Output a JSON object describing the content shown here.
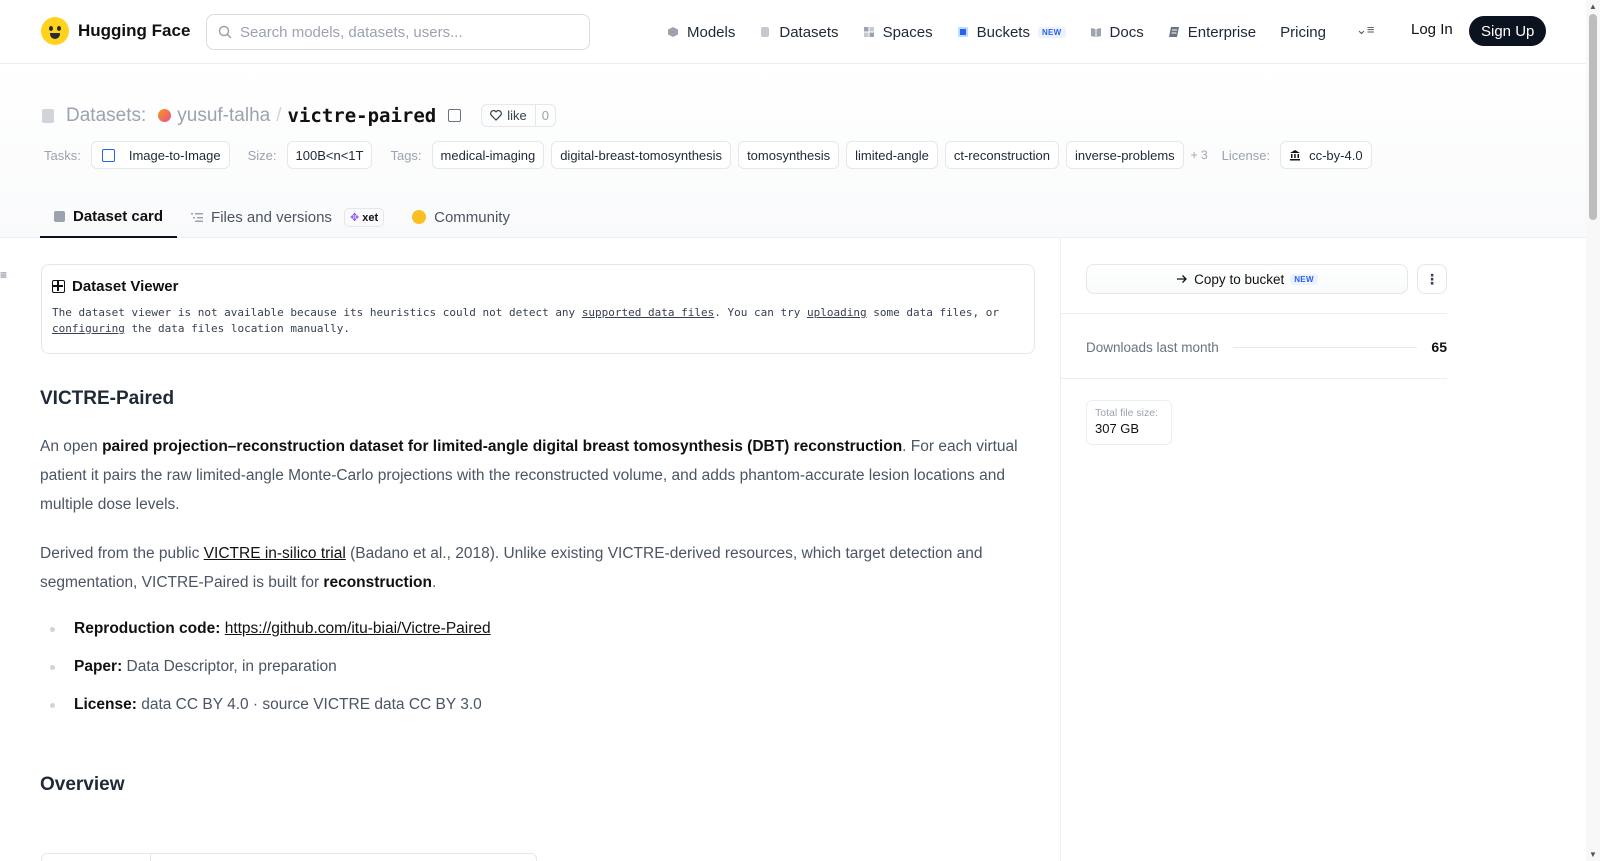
{
  "nav": {
    "brand": "Hugging Face",
    "search_placeholder": "Search models, datasets, users...",
    "links": [
      {
        "label": "Models",
        "icon": "cube-icon"
      },
      {
        "label": "Datasets",
        "icon": "database-icon"
      },
      {
        "label": "Spaces",
        "icon": "grid-icon"
      },
      {
        "label": "Buckets",
        "icon": "bucket-icon",
        "badge": "NEW"
      },
      {
        "label": "Docs",
        "icon": "book-icon"
      },
      {
        "label": "Enterprise",
        "icon": "enterprise-icon"
      },
      {
        "label": "Pricing"
      }
    ],
    "more_icon": "menu-icon",
    "login": "Log In",
    "signup": "Sign Up"
  },
  "header": {
    "section": "Datasets:",
    "owner": "yusuf-talha",
    "separator": "/",
    "repo": "victre-paired",
    "like_label": "like",
    "like_count": "0",
    "tasks_label": "Tasks:",
    "task": "Image-to-Image",
    "size_label": "Size:",
    "size": "100B<n<1T",
    "tags_label": "Tags:",
    "tags": [
      "medical-imaging",
      "digital-breast-tomosynthesis",
      "tomosynthesis",
      "limited-angle",
      "ct-reconstruction",
      "inverse-problems"
    ],
    "tags_more": "+ 3",
    "license_label": "License:",
    "license": "cc-by-4.0"
  },
  "tabs": {
    "card": "Dataset card",
    "files": "Files and versions",
    "xet": "xet",
    "community": "Community"
  },
  "viewer": {
    "title": "Dataset Viewer",
    "msg_1": "The dataset viewer is not available because its heuristics could not detect any ",
    "link_1": "supported data files",
    "msg_2": ". You can try ",
    "link_2": "uploading",
    "msg_3": " some data files, or ",
    "link_3": "configuring",
    "msg_4": " the data files location manually."
  },
  "card": {
    "heading": "VICTRE-Paired",
    "p1_pre": "An open ",
    "p1_bold": "paired projection–reconstruction dataset for limited-angle digital breast tomosynthesis (DBT) reconstruction",
    "p1_post": ". For each virtual patient it pairs the raw limited-angle Monte-Carlo projections with the reconstructed volume, and adds phantom-accurate lesion locations and multiple dose levels.",
    "p2_pre": "Derived from the public ",
    "p2_link": "VICTRE in-silico trial",
    "p2_mid": " (Badano et al., 2018). Unlike existing VICTRE-derived resources, which target detection and segmentation, VICTRE-Paired is built for ",
    "p2_bold": "reconstruction",
    "p2_post": ".",
    "bullets": [
      {
        "key": "Reproduction code:",
        "value": "",
        "link": "https://github.com/itu-biai/Victre-Paired"
      },
      {
        "key": "Paper:",
        "value": " Data Descriptor, in preparation"
      },
      {
        "key": "License:",
        "value": " data CC BY 4.0 · source VICTRE data CC BY 3.0"
      }
    ],
    "overview": "Overview"
  },
  "sidebar": {
    "copy_bucket": "Copy to bucket",
    "copy_badge": "NEW",
    "downloads_label": "Downloads last month",
    "downloads_value": "65",
    "size_label": "Total file size:",
    "size_value": "307 GB"
  }
}
